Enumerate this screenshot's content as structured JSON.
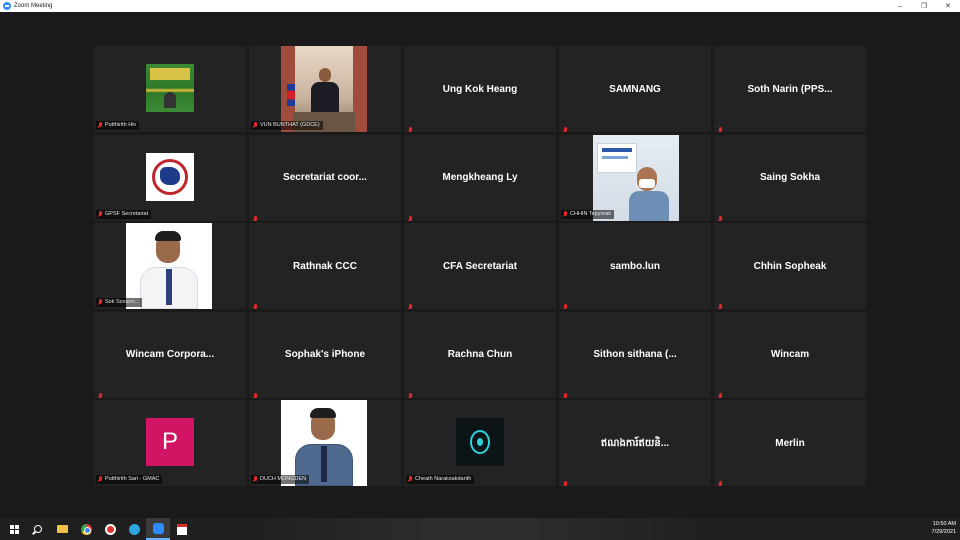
{
  "window": {
    "title": "Zoom Meeting",
    "minimize_glyph": "–",
    "maximize_glyph": "❐",
    "close_glyph": "✕"
  },
  "participants": [
    {
      "id": "p1",
      "label": "Putthirith Hiv",
      "display": "",
      "video": "green-banner"
    },
    {
      "id": "p2",
      "label": "VUN BUNTHAT (GDCE)",
      "display": "",
      "video": "conference-room"
    },
    {
      "id": "p3",
      "label": "",
      "display": "Ung Kok Heang"
    },
    {
      "id": "p4",
      "label": "",
      "display": "SAMNANG"
    },
    {
      "id": "p5",
      "label": "",
      "display": "Soth Narin (PPS..."
    },
    {
      "id": "p6",
      "label": "GPSF Secretariat",
      "display": "",
      "video": "logo"
    },
    {
      "id": "p7",
      "label": "",
      "display": "Secretariat coor..."
    },
    {
      "id": "p8",
      "label": "",
      "display": "Mengkheang Ly"
    },
    {
      "id": "p9",
      "label": "CHHIN Tepyreak",
      "display": "",
      "video": "masked-man"
    },
    {
      "id": "p10",
      "label": "",
      "display": "Saing Sokha"
    },
    {
      "id": "p11",
      "label": "Sok Sovann...",
      "display": "",
      "video": "portrait"
    },
    {
      "id": "p12",
      "label": "",
      "display": "Rathnak CCC"
    },
    {
      "id": "p13",
      "label": "",
      "display": "CFA Secretariat"
    },
    {
      "id": "p14",
      "label": "",
      "display": "sambo.lun"
    },
    {
      "id": "p15",
      "label": "",
      "display": "Chhin Sopheak"
    },
    {
      "id": "p16",
      "label": "",
      "display": "Wincam  Corpora..."
    },
    {
      "id": "p17",
      "label": "",
      "display": "Sophak's iPhone"
    },
    {
      "id": "p18",
      "label": "",
      "display": "Rachna Chun"
    },
    {
      "id": "p19",
      "label": "",
      "display": "Sithon sithana (..."
    },
    {
      "id": "p20",
      "label": "",
      "display": "Wincam"
    },
    {
      "id": "p21",
      "label": "Putthirith Sari - GMAC",
      "display": "",
      "video": "letter",
      "letter": "P"
    },
    {
      "id": "p22",
      "label": "DUCH MONGDEN",
      "display": "",
      "video": "portrait-uniform"
    },
    {
      "id": "p23",
      "label": "Cheath Naraksakdarith",
      "display": "",
      "video": "dark-logo"
    },
    {
      "id": "p24",
      "label": "",
      "display": "ឥណងការ៍ឥយនិ..."
    },
    {
      "id": "p25",
      "label": "",
      "display": "Merlin"
    }
  ],
  "taskbar": {
    "items": [
      "start-icon",
      "search-icon",
      "file-explorer-icon",
      "chrome-icon",
      "red-app-icon",
      "telegram-icon",
      "zoom-icon",
      "pdf-icon"
    ],
    "time": "10:50 AM",
    "date": "7/29/2021"
  },
  "colors": {
    "background": "#1a1a1a",
    "tile": "#232323",
    "muted_mic": "#e02828",
    "zoom_blue": "#2d8cff",
    "letter_avatar": "#d11464"
  }
}
